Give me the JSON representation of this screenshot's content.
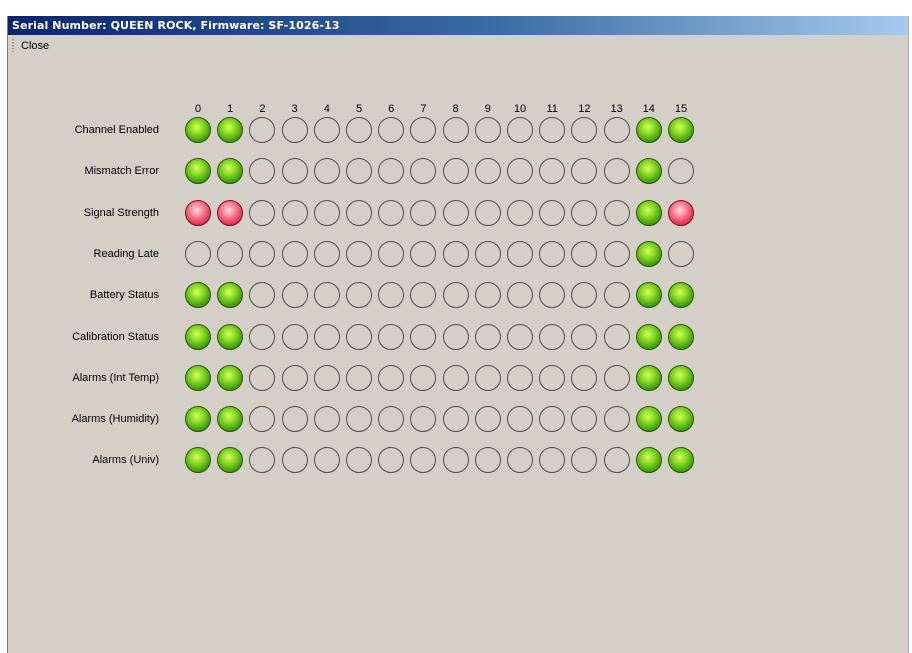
{
  "window": {
    "title": "Serial Number: QUEEN ROCK,  Firmware: SF-1026-13"
  },
  "menu": {
    "close_label": "Close"
  },
  "grid": {
    "columns": [
      "0",
      "1",
      "2",
      "3",
      "4",
      "5",
      "6",
      "7",
      "8",
      "9",
      "10",
      "11",
      "12",
      "13",
      "14",
      "15"
    ],
    "rows": [
      {
        "label": "Channel Enabled",
        "states": [
          "green",
          "green",
          "off",
          "off",
          "off",
          "off",
          "off",
          "off",
          "off",
          "off",
          "off",
          "off",
          "off",
          "off",
          "green",
          "green"
        ]
      },
      {
        "label": "Mismatch Error",
        "states": [
          "green",
          "green",
          "off",
          "off",
          "off",
          "off",
          "off",
          "off",
          "off",
          "off",
          "off",
          "off",
          "off",
          "off",
          "green",
          "off"
        ]
      },
      {
        "label": "Signal Strength",
        "states": [
          "red",
          "red",
          "off",
          "off",
          "off",
          "off",
          "off",
          "off",
          "off",
          "off",
          "off",
          "off",
          "off",
          "off",
          "green",
          "red"
        ]
      },
      {
        "label": "Reading Late",
        "states": [
          "off",
          "off",
          "off",
          "off",
          "off",
          "off",
          "off",
          "off",
          "off",
          "off",
          "off",
          "off",
          "off",
          "off",
          "green",
          "off"
        ]
      },
      {
        "label": "Battery Status",
        "states": [
          "green",
          "green",
          "off",
          "off",
          "off",
          "off",
          "off",
          "off",
          "off",
          "off",
          "off",
          "off",
          "off",
          "off",
          "green",
          "green"
        ]
      },
      {
        "label": "Calibration Status",
        "states": [
          "green",
          "green",
          "off",
          "off",
          "off",
          "off",
          "off",
          "off",
          "off",
          "off",
          "off",
          "off",
          "off",
          "off",
          "green",
          "green"
        ]
      },
      {
        "label": "Alarms (Int Temp)",
        "states": [
          "green",
          "green",
          "off",
          "off",
          "off",
          "off",
          "off",
          "off",
          "off",
          "off",
          "off",
          "off",
          "off",
          "off",
          "green",
          "green"
        ]
      },
      {
        "label": "Alarms (Humidity)",
        "states": [
          "green",
          "green",
          "off",
          "off",
          "off",
          "off",
          "off",
          "off",
          "off",
          "off",
          "off",
          "off",
          "off",
          "off",
          "green",
          "green"
        ]
      },
      {
        "label": "Alarms (Univ)",
        "states": [
          "green",
          "green",
          "off",
          "off",
          "off",
          "off",
          "off",
          "off",
          "off",
          "off",
          "off",
          "off",
          "off",
          "off",
          "green",
          "green"
        ]
      }
    ]
  },
  "colors": {
    "on": "#5cbf16",
    "error": "#e8435f",
    "off": "#d4d0c8",
    "titlebar": "#0a246a"
  }
}
